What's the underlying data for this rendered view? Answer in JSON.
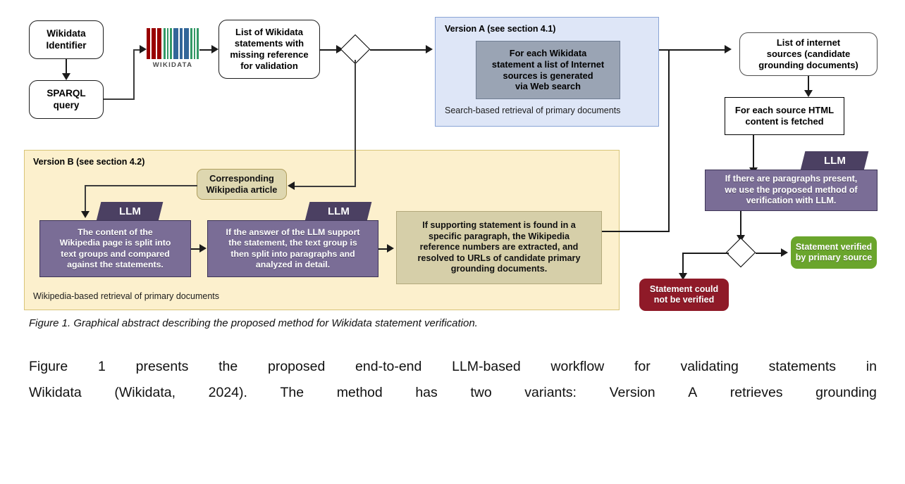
{
  "figure": {
    "caption": "Figure 1. Graphical abstract describing the proposed method for Wikidata statement verification."
  },
  "diagram": {
    "nodes": {
      "wikidata_identifier": "Wikidata\nIdentifier",
      "sparql_query": "SPARQL\nquery",
      "wikidata_logo_text": "WIKIDATA",
      "list_of_statements": "List of Wikidata\nstatements with\nmissing reference\nfor validation",
      "version_a_title": "Version A (see section 4.1)",
      "version_a_body": "For each Wikidata\nstatement a list of Internet\nsources is generated\nvia Web search",
      "version_a_footer": "Search-based retrieval of primary documents",
      "list_internet_sources": "List of internet\nsources (candidate\ngrounding documents)",
      "fetch_html": "For each source HTML\ncontent is fetched",
      "llm_verification_body": "If there are paragraphs present,\nwe use the proposed method of\nverification with LLM.",
      "statement_verified": "Statement verified\nby primary source",
      "statement_not_verified": "Statement could\nnot be verified",
      "version_b_title": "Version B (see section 4.2)",
      "version_b_footer": "Wikipedia-based retrieval of primary documents",
      "corresponding_wikipedia_article": "Corresponding\nWikipedia article",
      "llm_split_body": "The content of the\nWikipedia page is split into\ntext groups and compared\nagainst the statements.",
      "llm_paragraph_body": "If the answer of the LLM  support\nthe statement, the text group is\nthen split into paragraphs and\nanalyzed in detail.",
      "resolve_urls_body": "If supporting statement is found in a\nspecific paragraph, the Wikipedia\nreference numbers are extracted, and\nresolved to URLs of candidate primary\ngrounding documents."
    },
    "llm_tab_label": "LLM",
    "colors": {
      "version_a_bg": "#dee6f7",
      "version_b_bg": "#fcf0cd",
      "llm_tab": "#4b4062",
      "llm_body": "#7a6d96",
      "tan_box": "#d6cfa9",
      "grey_box": "#9aa4b4",
      "verified_green": "#6aa52c",
      "not_verified_red": "#8f1a28"
    },
    "wikidata_logo_bars": [
      {
        "color": "#990000",
        "width": 7
      },
      {
        "color": "#ffffff",
        "width": 3
      },
      {
        "color": "#990000",
        "width": 10
      },
      {
        "color": "#ffffff",
        "width": 3
      },
      {
        "color": "#990000",
        "width": 10
      },
      {
        "color": "#ffffff",
        "width": 4
      },
      {
        "color": "#339966",
        "width": 4
      },
      {
        "color": "#ffffff",
        "width": 3
      },
      {
        "color": "#339966",
        "width": 4
      },
      {
        "color": "#ffffff",
        "width": 3
      },
      {
        "color": "#339966",
        "width": 4
      },
      {
        "color": "#ffffff",
        "width": 4
      },
      {
        "color": "#336699",
        "width": 10
      },
      {
        "color": "#ffffff",
        "width": 3
      },
      {
        "color": "#336699",
        "width": 7
      },
      {
        "color": "#ffffff",
        "width": 3
      },
      {
        "color": "#336699",
        "width": 10
      },
      {
        "color": "#ffffff",
        "width": 4
      },
      {
        "color": "#339966",
        "width": 4
      },
      {
        "color": "#ffffff",
        "width": 3
      },
      {
        "color": "#339966",
        "width": 4
      },
      {
        "color": "#ffffff",
        "width": 3
      },
      {
        "color": "#339966",
        "width": 4
      }
    ]
  },
  "body": {
    "line1_parts": [
      "Figure",
      "1",
      "presents",
      "the",
      "proposed",
      "end-to-end",
      "LLM-based",
      "workflow",
      "for",
      "validating",
      "statements",
      "in"
    ],
    "line2_parts": [
      "Wikidata",
      "(Wikidata,",
      "2024).",
      "The",
      "method",
      "has",
      "two",
      "variants:",
      "Version",
      "A",
      "retrieves",
      "grounding"
    ]
  }
}
